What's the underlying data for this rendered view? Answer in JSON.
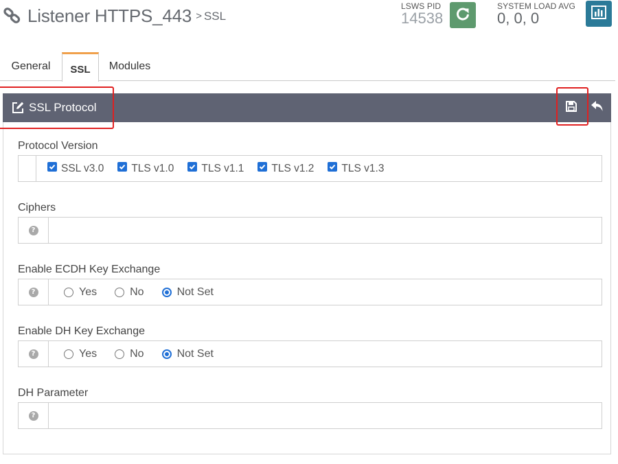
{
  "header": {
    "title": "Listener HTTPS_443",
    "separator": ">",
    "subtitle": "SSL",
    "pid_label": "LSWS PID",
    "pid_value": "14538",
    "load_label": "SYSTEM LOAD AVG",
    "load_value": "0, 0, 0",
    "icons": [
      "link-icon",
      "restart-icon",
      "chart-icon"
    ]
  },
  "tabs": [
    {
      "label": "General",
      "active": false
    },
    {
      "label": "SSL",
      "active": true
    },
    {
      "label": "Modules",
      "active": false
    }
  ],
  "panel": {
    "title": "SSL Protocol",
    "icons": [
      "edit-icon",
      "save-icon",
      "undo-icon"
    ]
  },
  "fields": {
    "protocol_version": {
      "label": "Protocol Version",
      "options": [
        {
          "label": "SSL v3.0",
          "checked": true
        },
        {
          "label": "TLS v1.0",
          "checked": true
        },
        {
          "label": "TLS v1.1",
          "checked": true
        },
        {
          "label": "TLS v1.2",
          "checked": true
        },
        {
          "label": "TLS v1.3",
          "checked": true
        }
      ]
    },
    "ciphers": {
      "label": "Ciphers",
      "value": ""
    },
    "ecdh": {
      "label": "Enable ECDH Key Exchange",
      "options": [
        {
          "label": "Yes",
          "selected": false
        },
        {
          "label": "No",
          "selected": false
        },
        {
          "label": "Not Set",
          "selected": true
        }
      ]
    },
    "dh": {
      "label": "Enable DH Key Exchange",
      "options": [
        {
          "label": "Yes",
          "selected": false
        },
        {
          "label": "No",
          "selected": false
        },
        {
          "label": "Not Set",
          "selected": true
        }
      ]
    },
    "dh_parameter": {
      "label": "DH Parameter",
      "value": ""
    }
  },
  "colors": {
    "panel_header": "#5f6373",
    "active_tab_accent": "#f0a04b",
    "restart_button": "#5e9a6e",
    "load_button": "#2b7a98",
    "checkbox": "#1f6fd6",
    "highlight": "#e02020"
  }
}
